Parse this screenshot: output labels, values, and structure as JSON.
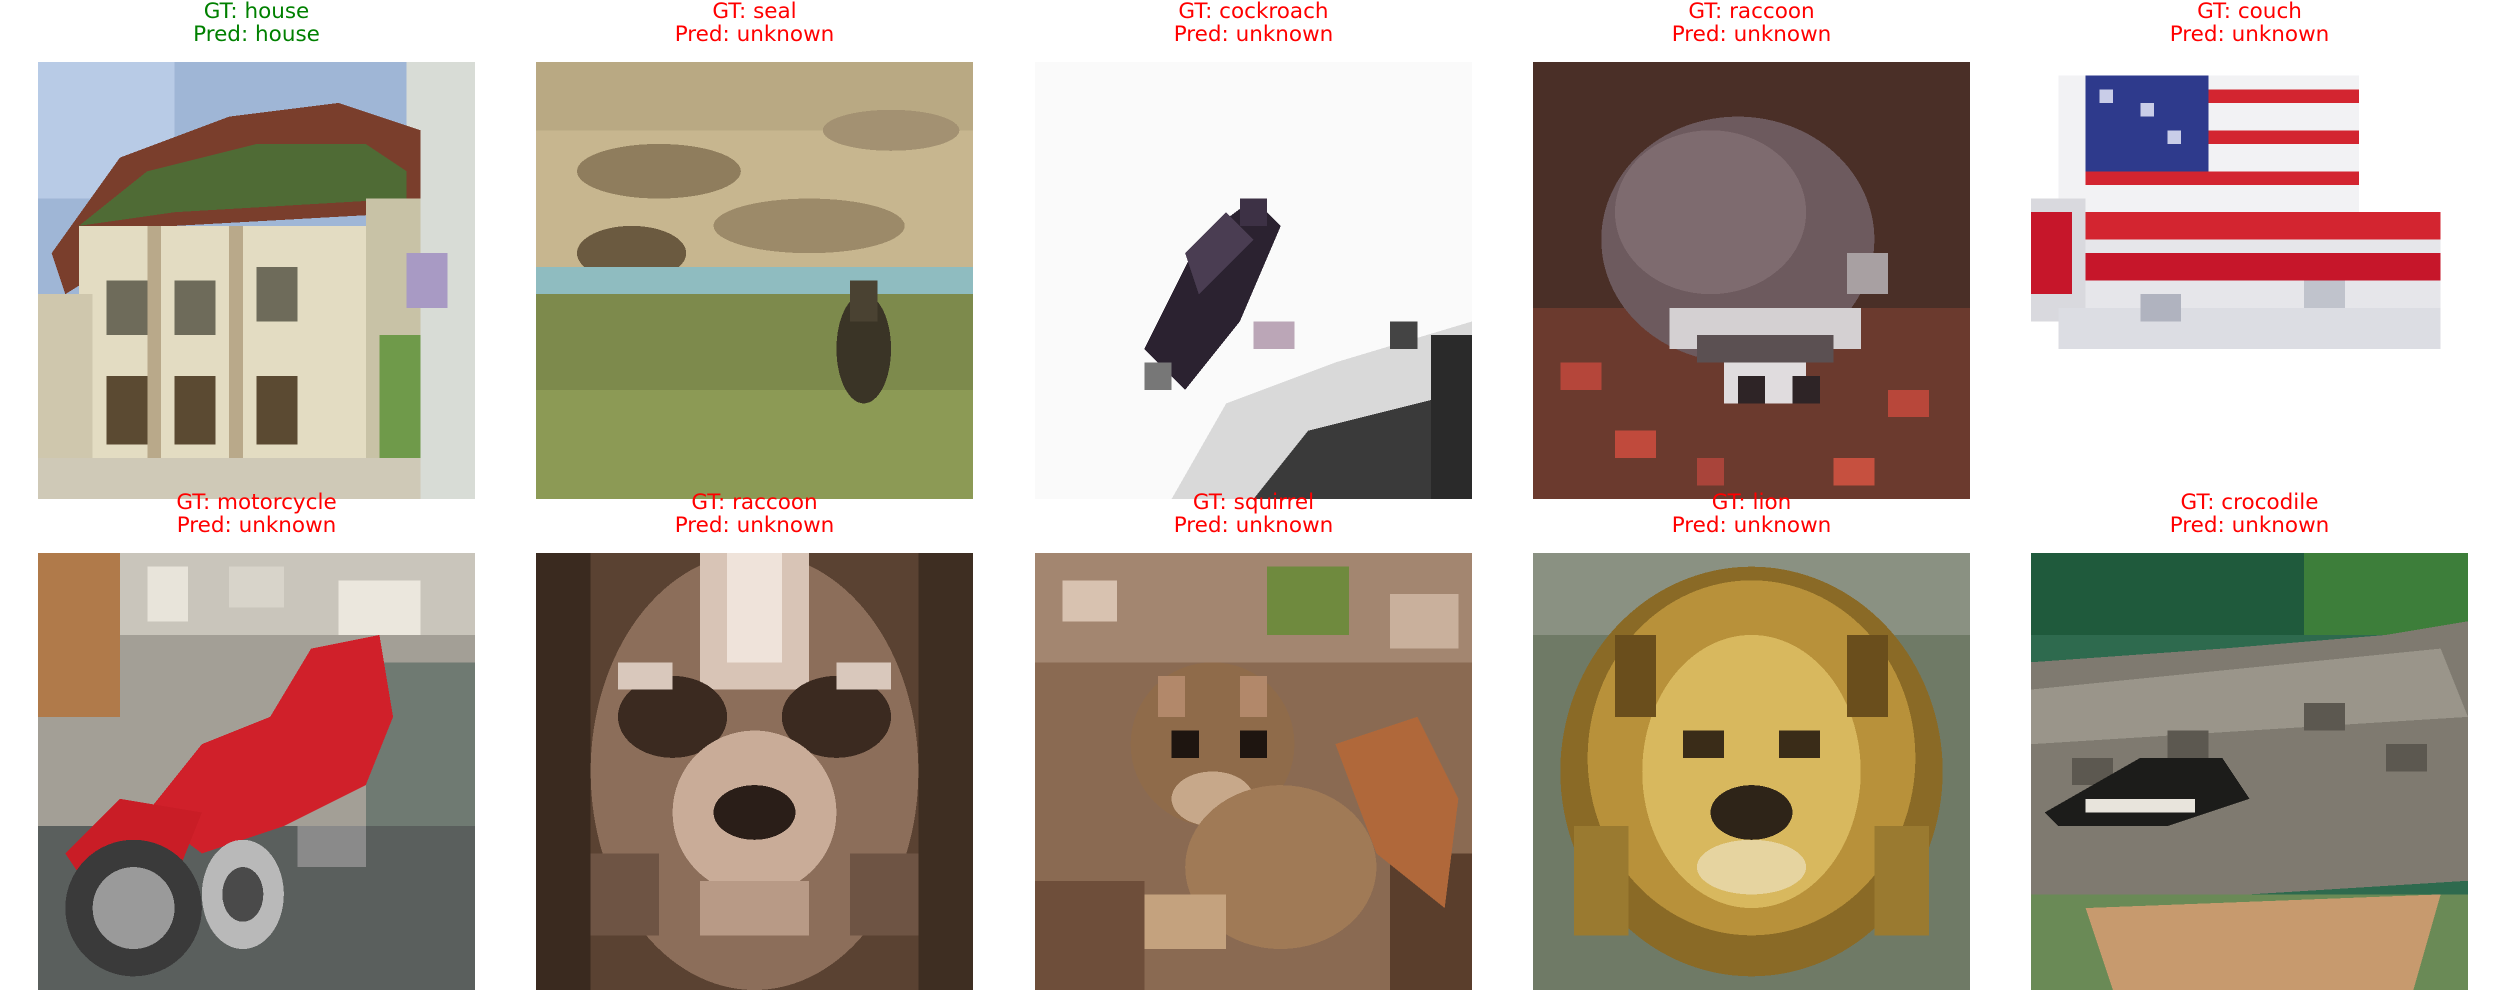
{
  "colors": {
    "correct": "#008000",
    "incorrect": "#ff0000"
  },
  "panels": [
    {
      "gt": "GT: house",
      "pred": "Pred: house",
      "status": "correct",
      "subject": "house"
    },
    {
      "gt": "GT: seal",
      "pred": "Pred: unknown",
      "status": "incorrect",
      "subject": "seal"
    },
    {
      "gt": "GT: cockroach",
      "pred": "Pred: unknown",
      "status": "incorrect",
      "subject": "cockroach"
    },
    {
      "gt": "GT: raccoon",
      "pred": "Pred: unknown",
      "status": "incorrect",
      "subject": "raccoon"
    },
    {
      "gt": "GT: couch",
      "pred": "Pred: unknown",
      "status": "incorrect",
      "subject": "couch"
    },
    {
      "gt": "GT: motorcycle",
      "pred": "Pred: unknown",
      "status": "incorrect",
      "subject": "motorcycle"
    },
    {
      "gt": "GT: raccoon",
      "pred": "Pred: unknown",
      "status": "incorrect",
      "subject": "raccoon-face"
    },
    {
      "gt": "GT: squirrel",
      "pred": "Pred: unknown",
      "status": "incorrect",
      "subject": "squirrel"
    },
    {
      "gt": "GT: lion",
      "pred": "Pred: unknown",
      "status": "incorrect",
      "subject": "lion"
    },
    {
      "gt": "GT: crocodile",
      "pred": "Pred: unknown",
      "status": "incorrect",
      "subject": "crocodile"
    }
  ]
}
